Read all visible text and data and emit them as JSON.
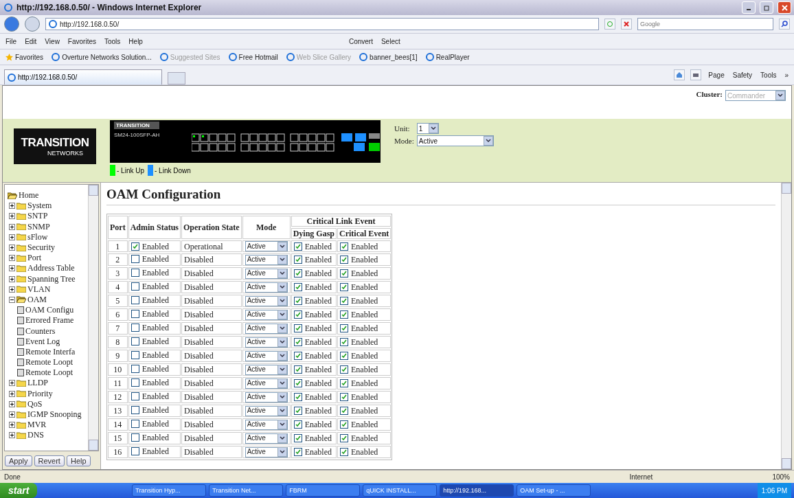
{
  "window": {
    "title": "http://192.168.0.50/ - Windows Internet Explorer"
  },
  "address_bar": {
    "value": "http://192.168.0.50/",
    "search_placeholder": "Google"
  },
  "menu_bar": [
    "File",
    "Edit",
    "View",
    "Favorites",
    "Tools",
    "Help"
  ],
  "command_items": [
    "Convert",
    "Select"
  ],
  "favorites_bar": [
    {
      "label": "Favorites",
      "dimmed": false
    },
    {
      "label": "Overture Networks Solution...",
      "dimmed": false
    },
    {
      "label": "Suggested Sites",
      "dimmed": true
    },
    {
      "label": "Free Hotmail",
      "dimmed": false
    },
    {
      "label": "Web Slice Gallery",
      "dimmed": true
    },
    {
      "label": "banner_bees[1]",
      "dimmed": false
    },
    {
      "label": "RealPlayer",
      "dimmed": false
    }
  ],
  "tab": {
    "label": "http://192.168.0.50/"
  },
  "command_bar": [
    "Page",
    "Safety",
    "Tools",
    "»"
  ],
  "header": {
    "cluster_label": "Cluster:",
    "cluster_value": "Commander",
    "unit_label": "Unit:",
    "unit_value": "1",
    "mode_label": "Mode:",
    "mode_value": "Active",
    "logo_top": "TRANSITION",
    "logo_bottom": "NETWORKS",
    "switch_logo": "TRANSITION",
    "switch_model": "SM24-100SFP-AH",
    "legend": [
      {
        "label": "- Link Up",
        "color": "#00ff00"
      },
      {
        "label": "- Link Down",
        "color": "#1e90ff"
      }
    ]
  },
  "sidebar": {
    "items": [
      {
        "label": "Home",
        "expanded": true,
        "children": [
          {
            "label": "System",
            "expanded": false
          },
          {
            "label": "SNTP",
            "expanded": false
          },
          {
            "label": "SNMP",
            "expanded": false
          },
          {
            "label": "sFlow",
            "expanded": false
          },
          {
            "label": "Security",
            "expanded": false
          },
          {
            "label": "Port",
            "expanded": false
          },
          {
            "label": "Address Table",
            "expanded": false
          },
          {
            "label": "Spanning Tree",
            "expanded": false
          },
          {
            "label": "VLAN",
            "expanded": false
          },
          {
            "label": "OAM",
            "expanded": true,
            "children": [
              {
                "label": "OAM Configu"
              },
              {
                "label": "Errored Frame"
              },
              {
                "label": "Counters"
              },
              {
                "label": "Event Log"
              },
              {
                "label": "Remote Interfa"
              },
              {
                "label": "Remote Loopt"
              },
              {
                "label": "Remote Loopt"
              }
            ]
          },
          {
            "label": "LLDP",
            "expanded": false
          },
          {
            "label": "Priority",
            "expanded": false
          },
          {
            "label": "QoS",
            "expanded": false
          },
          {
            "label": "IGMP Snooping",
            "expanded": false
          },
          {
            "label": "MVR",
            "expanded": false
          },
          {
            "label": "DNS",
            "expanded": false
          }
        ]
      }
    ],
    "buttons": [
      "Apply",
      "Revert",
      "Help"
    ]
  },
  "page": {
    "title": "OAM Configuration",
    "table": {
      "columns": [
        "Port",
        "Admin Status",
        "Operation State",
        "Mode",
        "Critical Link Event",
        "Dying Gasp",
        "Critical Event"
      ],
      "rows": [
        {
          "port": "1",
          "admin_checked": true,
          "admin_label": "Enabled",
          "state": "Operational",
          "mode": "Active",
          "gasp_checked": true,
          "gasp_label": "Enabled",
          "critical_checked": true,
          "critical_label": "Enabled"
        },
        {
          "port": "2",
          "admin_checked": false,
          "admin_label": "Enabled",
          "state": "Disabled",
          "mode": "Active",
          "gasp_checked": true,
          "gasp_label": "Enabled",
          "critical_checked": true,
          "critical_label": "Enabled"
        },
        {
          "port": "3",
          "admin_checked": false,
          "admin_label": "Enabled",
          "state": "Disabled",
          "mode": "Active",
          "gasp_checked": true,
          "gasp_label": "Enabled",
          "critical_checked": true,
          "critical_label": "Enabled"
        },
        {
          "port": "4",
          "admin_checked": false,
          "admin_label": "Enabled",
          "state": "Disabled",
          "mode": "Active",
          "gasp_checked": true,
          "gasp_label": "Enabled",
          "critical_checked": true,
          "critical_label": "Enabled"
        },
        {
          "port": "5",
          "admin_checked": false,
          "admin_label": "Enabled",
          "state": "Disabled",
          "mode": "Active",
          "gasp_checked": true,
          "gasp_label": "Enabled",
          "critical_checked": true,
          "critical_label": "Enabled"
        },
        {
          "port": "6",
          "admin_checked": false,
          "admin_label": "Enabled",
          "state": "Disabled",
          "mode": "Active",
          "gasp_checked": true,
          "gasp_label": "Enabled",
          "critical_checked": true,
          "critical_label": "Enabled"
        },
        {
          "port": "7",
          "admin_checked": false,
          "admin_label": "Enabled",
          "state": "Disabled",
          "mode": "Active",
          "gasp_checked": true,
          "gasp_label": "Enabled",
          "critical_checked": true,
          "critical_label": "Enabled"
        },
        {
          "port": "8",
          "admin_checked": false,
          "admin_label": "Enabled",
          "state": "Disabled",
          "mode": "Active",
          "gasp_checked": true,
          "gasp_label": "Enabled",
          "critical_checked": true,
          "critical_label": "Enabled"
        },
        {
          "port": "9",
          "admin_checked": false,
          "admin_label": "Enabled",
          "state": "Disabled",
          "mode": "Active",
          "gasp_checked": true,
          "gasp_label": "Enabled",
          "critical_checked": true,
          "critical_label": "Enabled"
        },
        {
          "port": "10",
          "admin_checked": false,
          "admin_label": "Enabled",
          "state": "Disabled",
          "mode": "Active",
          "gasp_checked": true,
          "gasp_label": "Enabled",
          "critical_checked": true,
          "critical_label": "Enabled"
        },
        {
          "port": "11",
          "admin_checked": false,
          "admin_label": "Enabled",
          "state": "Disabled",
          "mode": "Active",
          "gasp_checked": true,
          "gasp_label": "Enabled",
          "critical_checked": true,
          "critical_label": "Enabled"
        },
        {
          "port": "12",
          "admin_checked": false,
          "admin_label": "Enabled",
          "state": "Disabled",
          "mode": "Active",
          "gasp_checked": true,
          "gasp_label": "Enabled",
          "critical_checked": true,
          "critical_label": "Enabled"
        },
        {
          "port": "13",
          "admin_checked": false,
          "admin_label": "Enabled",
          "state": "Disabled",
          "mode": "Active",
          "gasp_checked": true,
          "gasp_label": "Enabled",
          "critical_checked": true,
          "critical_label": "Enabled"
        },
        {
          "port": "14",
          "admin_checked": false,
          "admin_label": "Enabled",
          "state": "Disabled",
          "mode": "Active",
          "gasp_checked": true,
          "gasp_label": "Enabled",
          "critical_checked": true,
          "critical_label": "Enabled"
        },
        {
          "port": "15",
          "admin_checked": false,
          "admin_label": "Enabled",
          "state": "Disabled",
          "mode": "Active",
          "gasp_checked": true,
          "gasp_label": "Enabled",
          "critical_checked": true,
          "critical_label": "Enabled"
        },
        {
          "port": "16",
          "admin_checked": false,
          "admin_label": "Enabled",
          "state": "Disabled",
          "mode": "Active",
          "gasp_checked": true,
          "gasp_label": "Enabled",
          "critical_checked": true,
          "critical_label": "Enabled"
        }
      ]
    }
  },
  "status_bar": {
    "text": "Done",
    "zone": "Internet",
    "zoom": "100%"
  },
  "taskbar": {
    "start": "start",
    "tasks": [
      {
        "label": "Transition Hyp...",
        "selected": false
      },
      {
        "label": "Transition Net...",
        "selected": false
      },
      {
        "label": "FBRM",
        "selected": false
      },
      {
        "label": "qUICK INSTALL...",
        "selected": false
      },
      {
        "label": "http://192.168...",
        "selected": true
      },
      {
        "label": "OAM Set-up - ...",
        "selected": false
      }
    ],
    "clock": "1:06 PM"
  }
}
